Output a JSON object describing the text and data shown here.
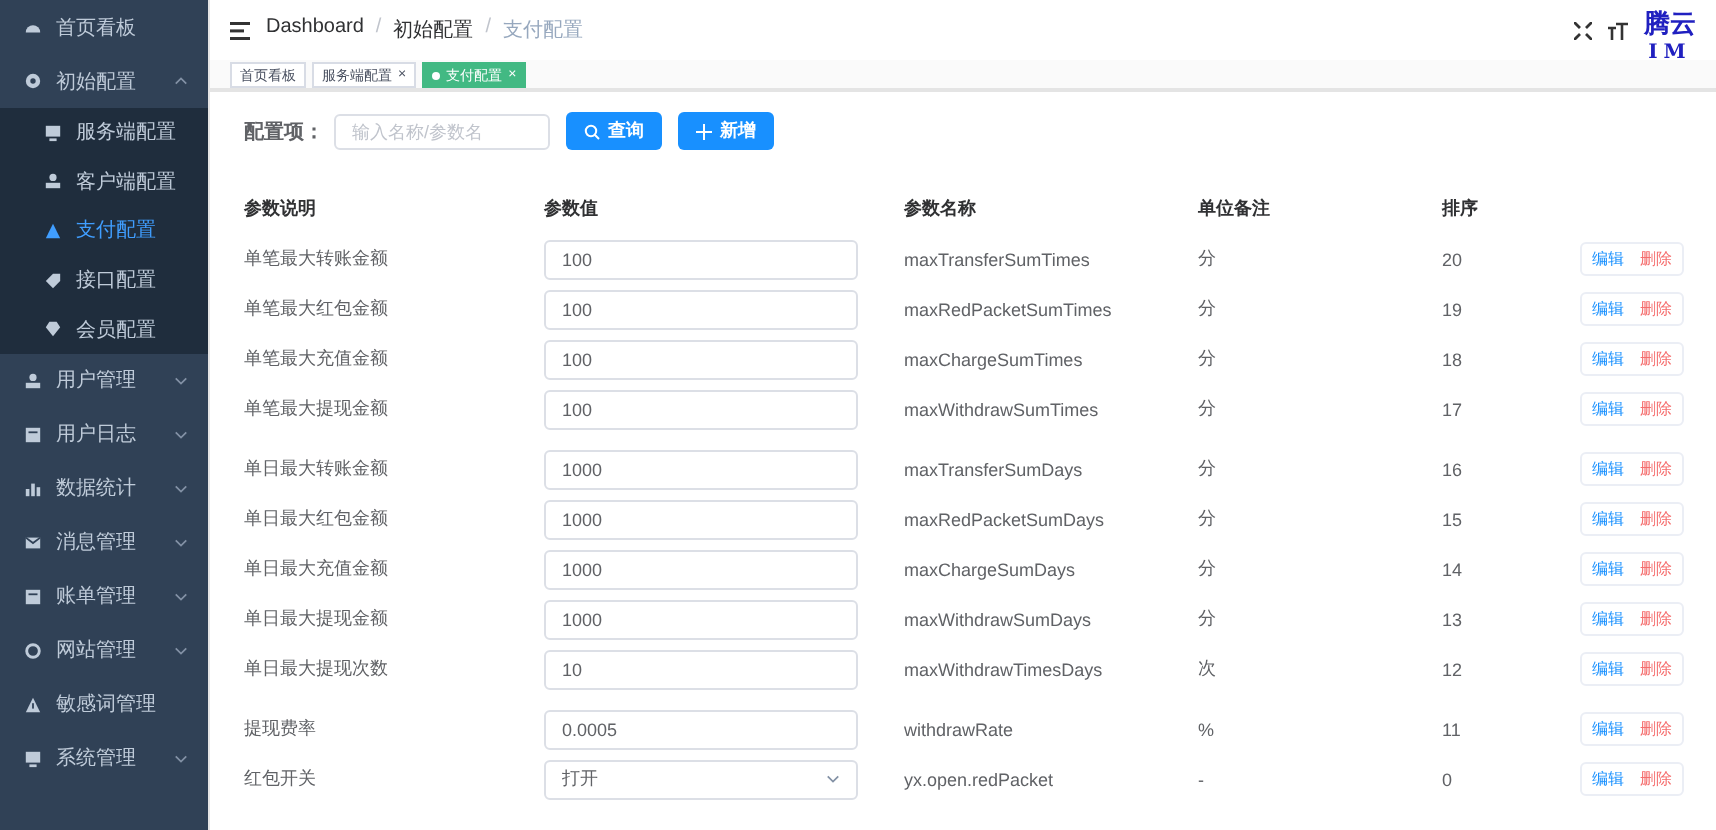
{
  "sidebar": {
    "items": [
      {
        "label": "首页看板",
        "kind": "link"
      },
      {
        "label": "初始配置",
        "kind": "group",
        "expanded": true,
        "children": [
          {
            "label": "服务端配置",
            "selected": false
          },
          {
            "label": "客户端配置",
            "selected": false
          },
          {
            "label": "支付配置",
            "selected": true
          },
          {
            "label": "接口配置",
            "selected": false
          },
          {
            "label": "会员配置",
            "selected": false
          }
        ]
      },
      {
        "label": "用户管理",
        "kind": "group",
        "expanded": false
      },
      {
        "label": "用户日志",
        "kind": "group",
        "expanded": false
      },
      {
        "label": "数据统计",
        "kind": "group",
        "expanded": false
      },
      {
        "label": "消息管理",
        "kind": "group",
        "expanded": false
      },
      {
        "label": "账单管理",
        "kind": "group",
        "expanded": false
      },
      {
        "label": "网站管理",
        "kind": "group",
        "expanded": false
      },
      {
        "label": "敏感词管理",
        "kind": "link"
      },
      {
        "label": "系统管理",
        "kind": "group",
        "expanded": false
      }
    ]
  },
  "header": {
    "breadcrumb": [
      "Dashboard",
      "初始配置",
      "支付配置"
    ],
    "breadcrumb_separator": "/",
    "logo": {
      "name": "腾云",
      "sub": "IM"
    }
  },
  "tags": [
    {
      "label": "首页看板",
      "selected": false
    },
    {
      "label": "服务端配置",
      "selected": false,
      "close": "×"
    },
    {
      "label": "支付配置",
      "selected": true,
      "close": "×"
    }
  ],
  "filter": {
    "label": "配置项：",
    "placeholder": "输入名称/参数名",
    "search_button": "查询",
    "add_button": "新增"
  },
  "table": {
    "columns": [
      "参数说明",
      "参数值",
      "参数名称",
      "单位备注",
      "排序"
    ],
    "groups": [
      {
        "rows": [
          {
            "kind": "input",
            "description": "单笔最大转账金额",
            "value": "100",
            "name": "maxTransferSumTimes",
            "unit": "分",
            "sort": "20",
            "actions": [
              "编辑",
              "删除"
            ]
          },
          {
            "kind": "input",
            "description": "单笔最大红包金额",
            "value": "100",
            "name": "maxRedPacketSumTimes",
            "unit": "分",
            "sort": "19",
            "actions": [
              "编辑",
              "删除"
            ]
          },
          {
            "kind": "input",
            "description": "单笔最大充值金额",
            "value": "100",
            "name": "maxChargeSumTimes",
            "unit": "分",
            "sort": "18",
            "actions": [
              "编辑",
              "删除"
            ]
          },
          {
            "kind": "input",
            "description": "单笔最大提现金额",
            "value": "100",
            "name": "maxWithdrawSumTimes",
            "unit": "分",
            "sort": "17",
            "actions": [
              "编辑",
              "删除"
            ]
          }
        ]
      },
      {
        "rows": [
          {
            "kind": "input",
            "description": "单日最大转账金额",
            "value": "1000",
            "name": "maxTransferSumDays",
            "unit": "分",
            "sort": "16",
            "actions": [
              "编辑",
              "删除"
            ]
          },
          {
            "kind": "input",
            "description": "单日最大红包金额",
            "value": "1000",
            "name": "maxRedPacketSumDays",
            "unit": "分",
            "sort": "15",
            "actions": [
              "编辑",
              "删除"
            ]
          },
          {
            "kind": "input",
            "description": "单日最大充值金额",
            "value": "1000",
            "name": "maxChargeSumDays",
            "unit": "分",
            "sort": "14",
            "actions": [
              "编辑",
              "删除"
            ]
          },
          {
            "kind": "input",
            "description": "单日最大提现金额",
            "value": "1000",
            "name": "maxWithdrawSumDays",
            "unit": "分",
            "sort": "13",
            "actions": [
              "编辑",
              "删除"
            ]
          },
          {
            "kind": "input",
            "description": "单日最大提现次数",
            "value": "10",
            "name": "maxWithdrawTimesDays",
            "unit": "次",
            "sort": "12",
            "actions": [
              "编辑",
              "删除"
            ]
          }
        ]
      },
      {
        "rows": [
          {
            "kind": "input",
            "description": "提现费率",
            "value": "0.0005",
            "name": "withdrawRate",
            "unit": "%",
            "sort": "11",
            "actions": [
              "编辑",
              "删除"
            ]
          },
          {
            "kind": "select",
            "description": "红包开关",
            "value": "打开",
            "name": "yx.open.redPacket",
            "unit": "-",
            "sort": "0",
            "actions": [
              "编辑",
              "删除"
            ]
          }
        ]
      }
    ]
  }
}
